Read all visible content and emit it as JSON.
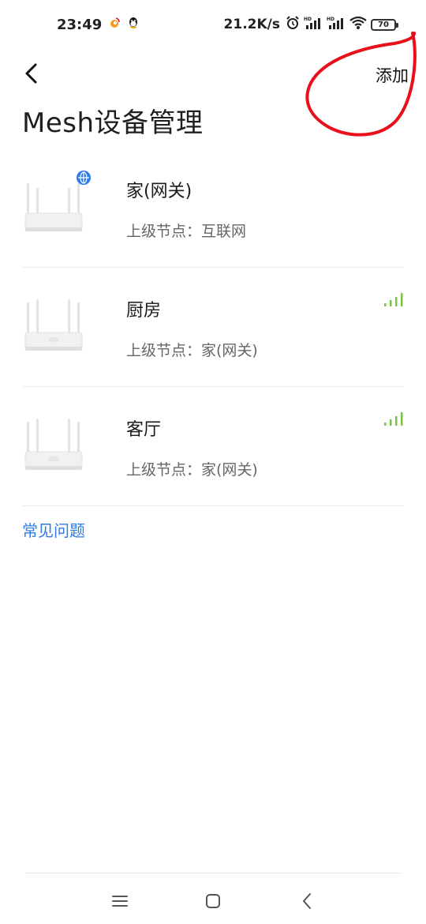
{
  "status_bar": {
    "time": "23:49",
    "network_speed": "21.2K/s",
    "battery": "70"
  },
  "header": {
    "add_label": "添加",
    "title": "Mesh设备管理"
  },
  "devices": [
    {
      "name": "家(网关)",
      "parent": "上级节点：互联网",
      "badge": "globe-icon"
    },
    {
      "name": "厨房",
      "parent": "上级节点：家(网关)",
      "signal": "signal-icon"
    },
    {
      "name": "客厅",
      "parent": "上级节点：家(网关)",
      "signal": "signal-icon"
    }
  ],
  "faq_label": "常见问题",
  "colors": {
    "accent": "#2f7be6",
    "signal": "#7cc242",
    "annotation": "#e8101a"
  }
}
